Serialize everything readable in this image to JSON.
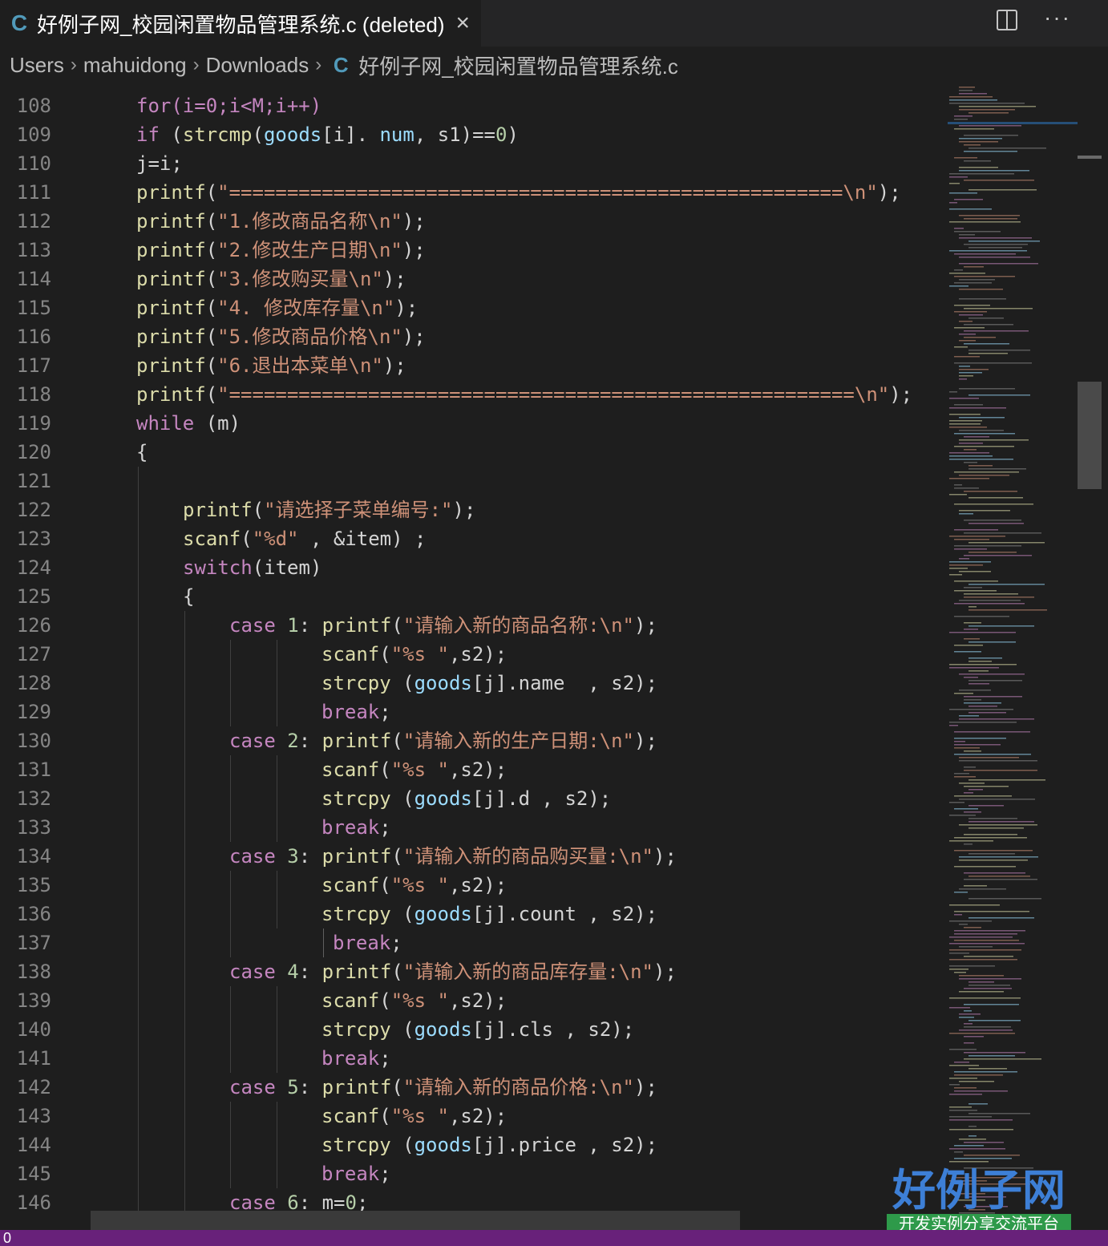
{
  "tab": {
    "title": "好例子网_校园闲置物品管理系统.c (deleted)",
    "icon": "c-file-icon",
    "close": "×"
  },
  "breadcrumb": {
    "items": [
      "Users",
      "mahuidong",
      "Downloads"
    ],
    "file": "好例子网_校园闲置物品管理系统.c",
    "separator": "›"
  },
  "editor": {
    "line_numbers": [
      "108",
      "109",
      "110",
      "111",
      "112",
      "113",
      "114",
      "115",
      "116",
      "117",
      "118",
      "119",
      "120",
      "121",
      "122",
      "123",
      "124",
      "125",
      "126",
      "127",
      "128",
      "129",
      "130",
      "131",
      "132",
      "133",
      "134",
      "135",
      "136",
      "137",
      "138",
      "139",
      "140",
      "141",
      "142",
      "143",
      "144",
      "145",
      "146"
    ]
  },
  "code_lines": {
    "l108": "for(i=0;i<M;i++)",
    "l109a": "if",
    "l109b": " (",
    "l109c": "strcmp",
    "l109d": "(",
    "l109e": "goods",
    "l109f": "[i]. ",
    "l109g": "num",
    "l109h": ", s1)==",
    "l109i": "0",
    "l109j": ")",
    "l110": "j=i;",
    "l111": "\"=====================================================\\n\"",
    "l112": "\"1.修改商品名称\\n\"",
    "l113": "\"2.修改生产日期\\n\"",
    "l114": "\"3.修改购买量\\n\"",
    "l115": "\"4. 修改库存量\\n\"",
    "l116": "\"5.修改商品价格\\n\"",
    "l117": "\"6.退出本菜单\\n\"",
    "l118": "\"======================================================\\n\"",
    "l119": "while",
    "l120": "{",
    "l122": "\"请选择子菜单编号:\"",
    "l123": "\"%d\"",
    "l124a": "switch",
    "l124b": "(item)",
    "l125": "{",
    "l126": "\"请输入新的商品名称:\\n\"",
    "l128": "name",
    "l130": "\"请输入新的生产日期:\\n\"",
    "l132": "d",
    "l134": "\"请输入新的商品购买量:\\n\"",
    "l136": "count",
    "l138": "\"请输入新的商品库存量:\\n\"",
    "l140": "cls",
    "l142": "\"请输入新的商品价格:\\n\"",
    "l144": "price",
    "case_kw": "case",
    "break_kw": "break",
    "printf": "printf",
    "scanf": "scanf",
    "strcpy": "strcpy",
    "goods": "goods",
    "scanf_str": "\"%s \"",
    "m_zero": "m=",
    "zero": "0"
  },
  "watermark": {
    "main": "好例子网",
    "sub": "开发实例分享交流平台"
  },
  "status": {
    "text": "0"
  },
  "colors": {
    "background": "#1e1e1e",
    "status_bar": "#68217a",
    "function": "#dcdcaa",
    "keyword": "#c586c0",
    "string": "#ce9178",
    "variable": "#9cdcfe",
    "number": "#b5cea8"
  }
}
